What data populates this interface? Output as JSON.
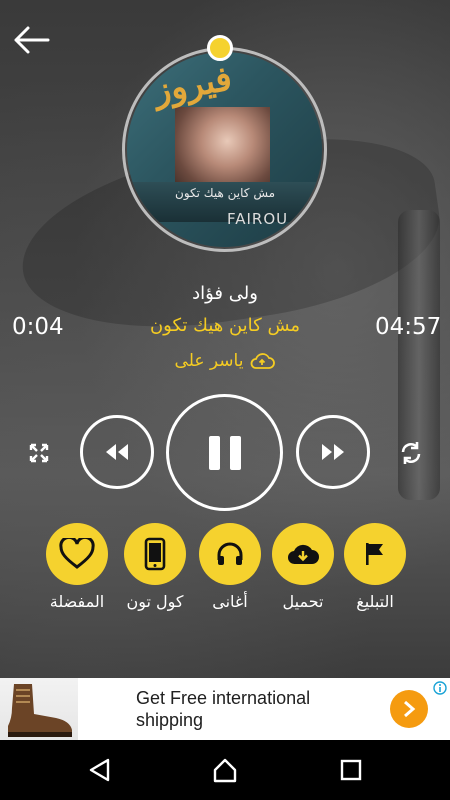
{
  "player": {
    "artist": "ولى فؤاد",
    "song_title": "مش كاين هيك تكون",
    "uploader": "ياسر على",
    "elapsed": "0:04",
    "duration": "04:57",
    "progress_fraction": 0.013
  },
  "cover": {
    "logo_text": "فيروز",
    "album_text": "مش كاين هيك تكون",
    "brand_text": "FAIROU"
  },
  "actions": [
    {
      "label": "المفضلة",
      "icon": "heart-icon"
    },
    {
      "label": "كول تون",
      "icon": "phone-icon"
    },
    {
      "label": "أغانى",
      "icon": "headphones-icon"
    },
    {
      "label": "تحميل",
      "icon": "download-icon"
    },
    {
      "label": "التبليغ",
      "icon": "flag-icon"
    }
  ],
  "ad": {
    "text": "Get Free international shipping"
  },
  "colors": {
    "accent": "#f5d22e",
    "song": "#f5cc22",
    "ad_arrow": "#f59b10"
  }
}
